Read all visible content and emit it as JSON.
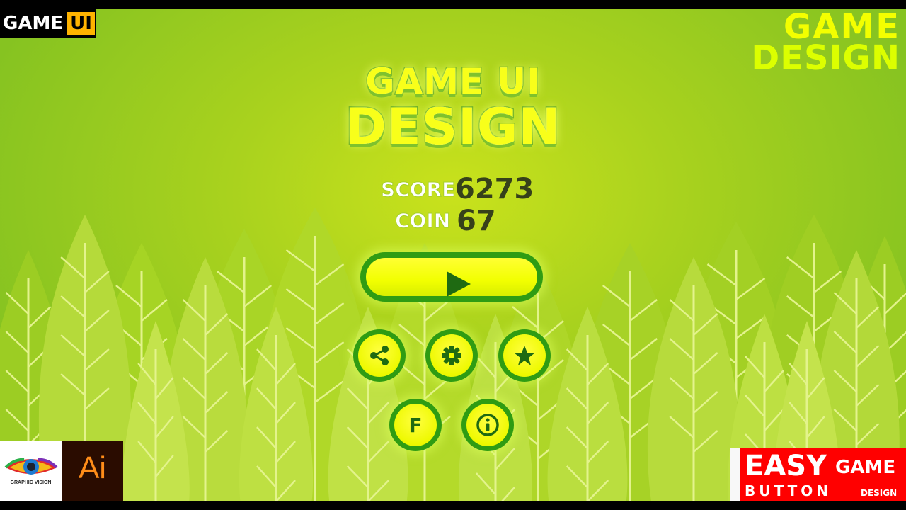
{
  "brand_top_left": {
    "word": "GAME",
    "badge": "UI"
  },
  "brand_top_right": {
    "line1": "GAME",
    "line2": "DESIGN"
  },
  "title": {
    "line1": "GAME UI",
    "line2": "DESIGN"
  },
  "stats": {
    "score_label": "SCORE",
    "score_value": "6273",
    "coin_label": "COIN",
    "coin_value": "67"
  },
  "buttons": {
    "play": {
      "icon": "play-icon"
    },
    "row1": [
      {
        "icon": "share-icon"
      },
      {
        "icon": "gear-icon"
      },
      {
        "icon": "star-icon"
      }
    ],
    "row2": [
      {
        "icon": "facebook-icon",
        "glyph": "F"
      },
      {
        "icon": "info-icon",
        "glyph": "i"
      }
    ]
  },
  "logos": {
    "graphic_vision": "GRAPHIC VISION",
    "illustrator": "Ai",
    "easy": {
      "easy": "EASY",
      "game": "GAME",
      "button": "BUTTON",
      "design": "DESIGN"
    }
  },
  "colors": {
    "background": "#a9d21e",
    "button_fill": "#f2ff00",
    "button_ring": "#2f9c13",
    "icon": "#1f6a12",
    "value_text": "#36411a"
  }
}
